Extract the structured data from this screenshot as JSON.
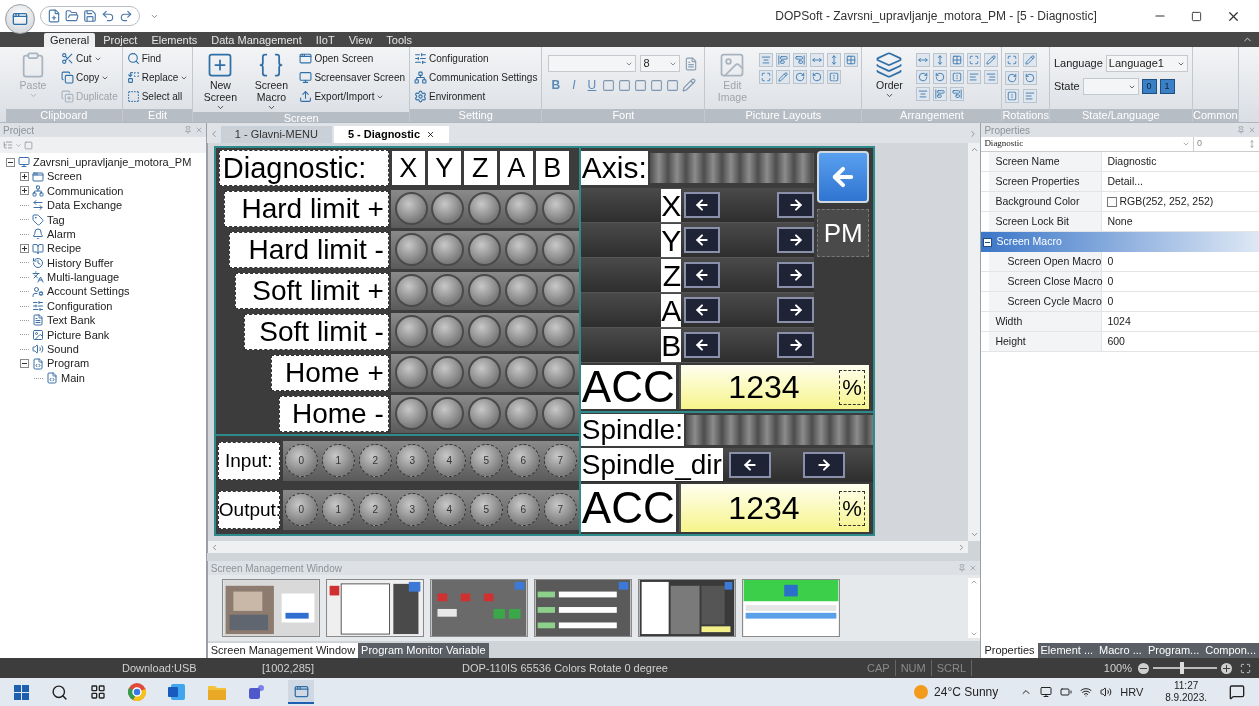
{
  "window": {
    "title": "DOPSoft - Zavrsni_upravljanje_motora_PM - [5 - Diagnostic]"
  },
  "ribbon_tabs": [
    {
      "label": "General",
      "selected": true
    },
    {
      "label": "Project",
      "selected": false
    },
    {
      "label": "Elements",
      "selected": false
    },
    {
      "label": "Data Management",
      "selected": false
    },
    {
      "label": "IIoT",
      "selected": false
    },
    {
      "label": "View",
      "selected": false
    },
    {
      "label": "Tools",
      "selected": false
    }
  ],
  "ribbon": [
    {
      "kind": "buttons",
      "label": "Clipboard",
      "items": [
        {
          "kind": "large",
          "label": "Paste",
          "dropdown": true,
          "disabled": true
        },
        {
          "kind": "small",
          "label": "Cut",
          "dropdown": true,
          "disabled": false
        },
        {
          "kind": "small",
          "label": "Copy",
          "dropdown": true,
          "disabled": false
        },
        {
          "kind": "small",
          "label": "Duplicate",
          "dropdown": false,
          "disabled": true
        }
      ]
    },
    {
      "kind": "buttons",
      "label": "Edit",
      "items": [
        {
          "kind": "small",
          "label": "Find",
          "dropdown": false,
          "disabled": false
        },
        {
          "kind": "small",
          "label": "Replace",
          "dropdown": true,
          "disabled": false
        },
        {
          "kind": "small",
          "label": "Select all",
          "dropdown": false,
          "disabled": false
        }
      ]
    },
    {
      "kind": "buttons",
      "label": "Screen",
      "items": [
        {
          "kind": "large",
          "label": "New Screen",
          "dropdown": true,
          "disabled": false
        },
        {
          "kind": "large",
          "label": "Screen Macro",
          "dropdown": true,
          "disabled": false
        },
        {
          "kind": "small",
          "label": "Open Screen",
          "dropdown": false,
          "disabled": false
        },
        {
          "kind": "small",
          "label": "Screensaver Screen",
          "dropdown": false,
          "disabled": false
        },
        {
          "kind": "small",
          "label": "Export/Import",
          "dropdown": true,
          "disabled": false
        }
      ]
    },
    {
      "kind": "buttons",
      "label": "Setting",
      "items": [
        {
          "kind": "small",
          "label": "Configuration",
          "dropdown": false,
          "disabled": false
        },
        {
          "kind": "small",
          "label": "Communication Settings",
          "dropdown": false,
          "disabled": false
        },
        {
          "kind": "small",
          "label": "Environment",
          "dropdown": false,
          "disabled": false
        }
      ]
    },
    {
      "kind": "font",
      "label": "Font",
      "size": "8",
      "format": [
        "B",
        "I",
        "U"
      ]
    },
    {
      "kind": "buttons",
      "label": "Picture Layouts",
      "items": [
        {
          "kind": "large",
          "label": "Edit Image",
          "dropdown": false,
          "disabled": true
        },
        {
          "kind": "icon-grid"
        }
      ]
    },
    {
      "kind": "buttons",
      "label": "Arrangement",
      "items": [
        {
          "kind": "large",
          "label": "Order",
          "dropdown": true,
          "disabled": false
        },
        {
          "kind": "icon-grid"
        }
      ]
    },
    {
      "kind": "buttons",
      "label": "Rotations",
      "items": [
        {
          "kind": "icon-grid"
        }
      ]
    },
    {
      "kind": "language",
      "label": "State/Language",
      "language_label": "Language",
      "language": "Language1",
      "state_label": "State",
      "state_buttons": [
        "0",
        "1"
      ]
    },
    {
      "kind": "buttons",
      "label": "Common"
    }
  ],
  "project": {
    "title": "Project",
    "tree": [
      {
        "label": "Zavrsni_upravljanje_motora_PM",
        "kind": "branch",
        "expanded": true,
        "children": [
          {
            "label": "Screen",
            "kind": "branch",
            "expanded": false
          },
          {
            "label": "Communication",
            "kind": "branch",
            "expanded": false
          },
          {
            "label": "Data Exchange",
            "kind": "leaf"
          },
          {
            "label": "Tag",
            "kind": "leaf"
          },
          {
            "label": "Alarm",
            "kind": "leaf"
          },
          {
            "label": "Recipe",
            "kind": "branch",
            "expanded": false
          },
          {
            "label": "History Buffer",
            "kind": "leaf"
          },
          {
            "label": "Multi-language",
            "kind": "leaf"
          },
          {
            "label": "Account Settings",
            "kind": "leaf"
          },
          {
            "label": "Configuration",
            "kind": "leaf"
          },
          {
            "label": "Text Bank",
            "kind": "leaf"
          },
          {
            "label": "Picture Bank",
            "kind": "leaf"
          },
          {
            "label": "Sound",
            "kind": "leaf"
          },
          {
            "label": "Program",
            "kind": "branch",
            "expanded": true,
            "children": [
              {
                "label": "Main",
                "kind": "leaf"
              }
            ]
          }
        ]
      }
    ]
  },
  "doc_tabs": [
    {
      "label": "1 - Glavni-MENU",
      "selected": false
    },
    {
      "label": "5 - Diagnostic",
      "selected": true
    }
  ],
  "hmi": {
    "title": "Diagnostic:",
    "axes": [
      "X",
      "Y",
      "Z",
      "A",
      "B"
    ],
    "rows": [
      {
        "label": "Hard limit +",
        "lamps": [
          false,
          false,
          false,
          false,
          false
        ]
      },
      {
        "label": "Hard limit -",
        "lamps": [
          false,
          false,
          false,
          false,
          false
        ]
      },
      {
        "label": "Soft limit +",
        "lamps": [
          false,
          false,
          false,
          false,
          false
        ]
      },
      {
        "label": "Soft limit -",
        "lamps": [
          false,
          false,
          false,
          false,
          false
        ]
      },
      {
        "label": "Home +",
        "lamps": [
          false,
          false,
          false,
          false,
          false
        ]
      },
      {
        "label": "Home -",
        "lamps": [
          false,
          false,
          false,
          false,
          false
        ]
      }
    ],
    "io": [
      {
        "label": "Input:",
        "lamps": [
          {
            "label": "0",
            "on": false
          },
          {
            "label": "1",
            "on": false
          },
          {
            "label": "2",
            "on": false
          },
          {
            "label": "3",
            "on": false
          },
          {
            "label": "4",
            "on": false
          },
          {
            "label": "5",
            "on": false
          },
          {
            "label": "6",
            "on": false
          },
          {
            "label": "7",
            "on": false
          }
        ]
      },
      {
        "label": "Output:",
        "lamps": [
          {
            "label": "0",
            "on": false
          },
          {
            "label": "1",
            "on": false
          },
          {
            "label": "2",
            "on": false
          },
          {
            "label": "3",
            "on": false
          },
          {
            "label": "4",
            "on": false
          },
          {
            "label": "5",
            "on": false
          },
          {
            "label": "6",
            "on": false
          },
          {
            "label": "7",
            "on": false
          }
        ]
      }
    ],
    "axis_title": "Axis:",
    "jog": [
      "X",
      "Y",
      "Z",
      "A",
      "B"
    ],
    "pm": "PM",
    "acc": {
      "label": "ACC",
      "value": "1234",
      "unit": "%"
    },
    "spindle_title": "Spindle:",
    "spindle_dir": "Spindle_dir",
    "spindle_acc": {
      "label": "ACC",
      "value": "1234",
      "unit": "%"
    }
  },
  "screen_manager": {
    "title": "Screen Management Window"
  },
  "bottom_tabs": [
    {
      "label": "Screen Management Window",
      "selected": true
    },
    {
      "label": "Program Monitor Variable",
      "selected": false
    }
  ],
  "properties": {
    "title": "Properties",
    "object": "Diagnostic",
    "object_index": "0",
    "rows": [
      {
        "kind": "text",
        "name": "Screen Name",
        "value": "Diagnostic"
      },
      {
        "kind": "text",
        "name": "Screen Properties",
        "value": "Detail..."
      },
      {
        "kind": "color",
        "name": "Background Color",
        "value": "RGB(252, 252, 252)"
      },
      {
        "kind": "text",
        "name": "Screen Lock Bit",
        "value": "None"
      },
      {
        "kind": "section",
        "name": "Screen Macro",
        "expanded": true,
        "children": [
          {
            "kind": "text",
            "name": "Screen Open Macro",
            "value": "0"
          },
          {
            "kind": "text",
            "name": "Screen Close Macro",
            "value": "0"
          },
          {
            "kind": "text",
            "name": "Screen Cycle Macro",
            "value": "0"
          }
        ]
      },
      {
        "kind": "text",
        "name": "Width",
        "value": "1024"
      },
      {
        "kind": "text",
        "name": "Height",
        "value": "600"
      }
    ]
  },
  "right_tabs": [
    {
      "label": "Properties",
      "selected": true
    },
    {
      "label": "Element ...",
      "selected": false
    },
    {
      "label": "Macro ...",
      "selected": false
    },
    {
      "label": "Program...",
      "selected": false
    },
    {
      "label": "Compon...",
      "selected": false
    }
  ],
  "status_bar": {
    "download": "Download:USB",
    "cursor": "[1002,285]",
    "device": "DOP-110IS 65536 Colors Rotate 0 degree",
    "keys": [
      "CAP",
      "NUM",
      "SCRL"
    ],
    "zoom": "100%",
    "zoom_slider": {
      "level": 0.45
    }
  },
  "taskbar": {
    "weather": "24°C Sunny",
    "language": "HRV",
    "time": "11:27",
    "date": "8.9.2023."
  }
}
